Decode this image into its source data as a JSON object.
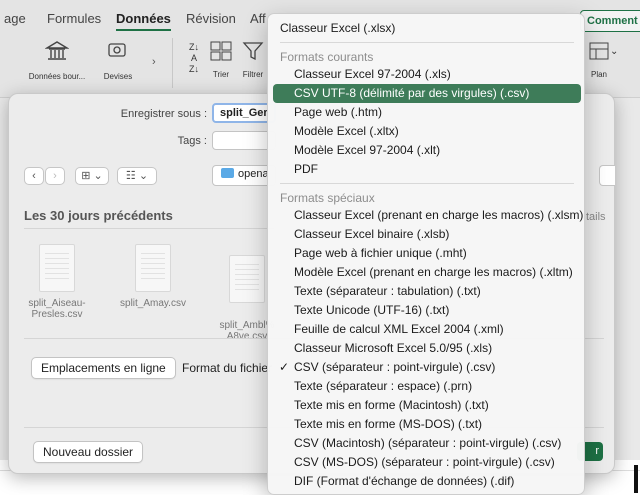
{
  "ribbon": {
    "tabs": [
      "age",
      "Formules",
      "Données",
      "Révision",
      "Aff"
    ],
    "active_tab": "Données",
    "comment_label": "Comment",
    "buttons": {
      "data_sources": "Données bour...",
      "currencies": "Devises",
      "sort": "Trier",
      "filter": "Filtrer",
      "plan": "Plan"
    }
  },
  "dialog": {
    "save_as_label": "Enregistrer sous :",
    "filename_value": "split_Ger",
    "tags_label": "Tags :",
    "location_value": "opena",
    "section_title": "Les 30 jours précédents",
    "details_partial": "tails",
    "files": [
      {
        "name": "split_Aiseau-Presles.csv"
      },
      {
        "name": "split_Amay.csv"
      },
      {
        "name": "split_Ambl%\nA8ve.csv"
      }
    ],
    "online_locations_button": "Emplacements en ligne",
    "file_format_label": "Format du fichier",
    "new_folder_button": "Nouveau dossier",
    "save_button_partial": "r"
  },
  "menu": {
    "top_item": "Classeur Excel (.xlsx)",
    "common_header": "Formats courants",
    "common_items": [
      "Classeur Excel 97-2004 (.xls)",
      "CSV UTF-8 (délimité par des virgules) (.csv)",
      "Page web (.htm)",
      "Modèle Excel (.xltx)",
      "Modèle Excel 97-2004 (.xlt)",
      "PDF"
    ],
    "selected_item": "CSV UTF-8 (délimité par des virgules) (.csv)",
    "special_header": "Formats spéciaux",
    "special_items": [
      "Classeur Excel (prenant en charge les macros) (.xlsm)",
      "Classeur Excel binaire (.xlsb)",
      "Page web à fichier unique (.mht)",
      "Modèle Excel (prenant en charge les macros) (.xltm)",
      "Texte (séparateur : tabulation) (.txt)",
      "Texte Unicode (UTF-16) (.txt)",
      "Feuille de calcul XML Excel 2004 (.xml)",
      "Classeur Microsoft Excel 5.0/95 (.xls)",
      "CSV (séparateur : point-virgule) (.csv)",
      "Texte (séparateur : espace) (.prn)",
      "Texte mis en forme (Macintosh) (.txt)",
      "Texte mis en forme (MS-DOS) (.txt)",
      "CSV (Macintosh) (séparateur : point-virgule) (.csv)",
      "CSV (MS-DOS) (séparateur : point-virgule) (.csv)",
      "DIF (Format d'échange de données) (.dif)"
    ],
    "checked_item": "CSV (séparateur : point-virgule) (.csv)"
  },
  "colors": {
    "accent": "#1e7145",
    "selection": "#3e7c59"
  }
}
